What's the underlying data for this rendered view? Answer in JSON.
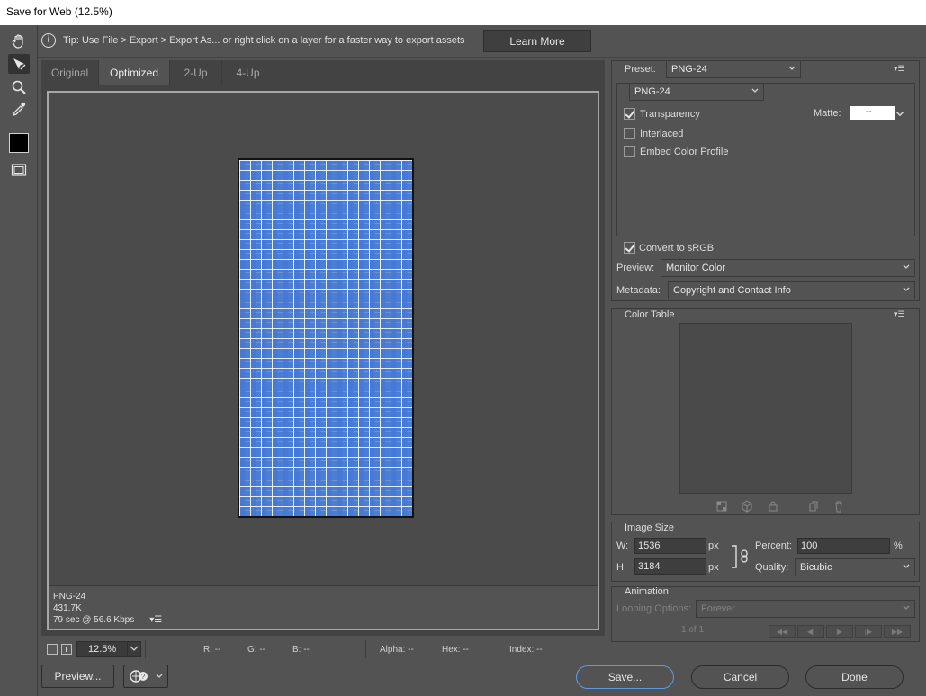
{
  "window": {
    "title": "Save for Web (12.5%)"
  },
  "tip": {
    "text": "Tip: Use File > Export > Export As...  or right click on a layer for a faster way to export assets",
    "learn_more": "Learn More"
  },
  "tabs": [
    {
      "label": "Original"
    },
    {
      "label": "Optimized"
    },
    {
      "label": "2-Up"
    },
    {
      "label": "4-Up"
    }
  ],
  "canvas_info": {
    "format": "PNG-24",
    "size": "431.7K",
    "speed": "79 sec @ 56.6 Kbps"
  },
  "status": {
    "zoom": "12.5%",
    "r": "R: --",
    "g": "G: --",
    "b": "B: --",
    "alpha": "Alpha: --",
    "hex": "Hex: --",
    "index": "Index: --"
  },
  "footer": {
    "preview": "Preview...",
    "save": "Save...",
    "cancel": "Cancel",
    "done": "Done"
  },
  "settings": {
    "preset_label": "Preset:",
    "preset_value": "PNG-24",
    "format_value": "PNG-24",
    "transparency": "Transparency",
    "matte_label": "Matte:",
    "matte_value": "--",
    "interlaced": "Interlaced",
    "embed_profile": "Embed Color Profile",
    "convert_srgb": "Convert to sRGB",
    "preview_label": "Preview:",
    "preview_value": "Monitor Color",
    "metadata_label": "Metadata:",
    "metadata_value": "Copyright and Contact Info",
    "color_table": "Color Table"
  },
  "image_size": {
    "title": "Image Size",
    "w_label": "W:",
    "w_value": "1536",
    "h_label": "H:",
    "h_value": "3184",
    "px": "px",
    "percent_label": "Percent:",
    "percent_value": "100",
    "percent_unit": "%",
    "quality_label": "Quality:",
    "quality_value": "Bicubic"
  },
  "animation": {
    "title": "Animation",
    "looping_label": "Looping Options:",
    "looping_value": "Forever",
    "frame": "1 of 1"
  },
  "colors": {
    "accent": "#5b9be6",
    "bg": "#535353"
  }
}
